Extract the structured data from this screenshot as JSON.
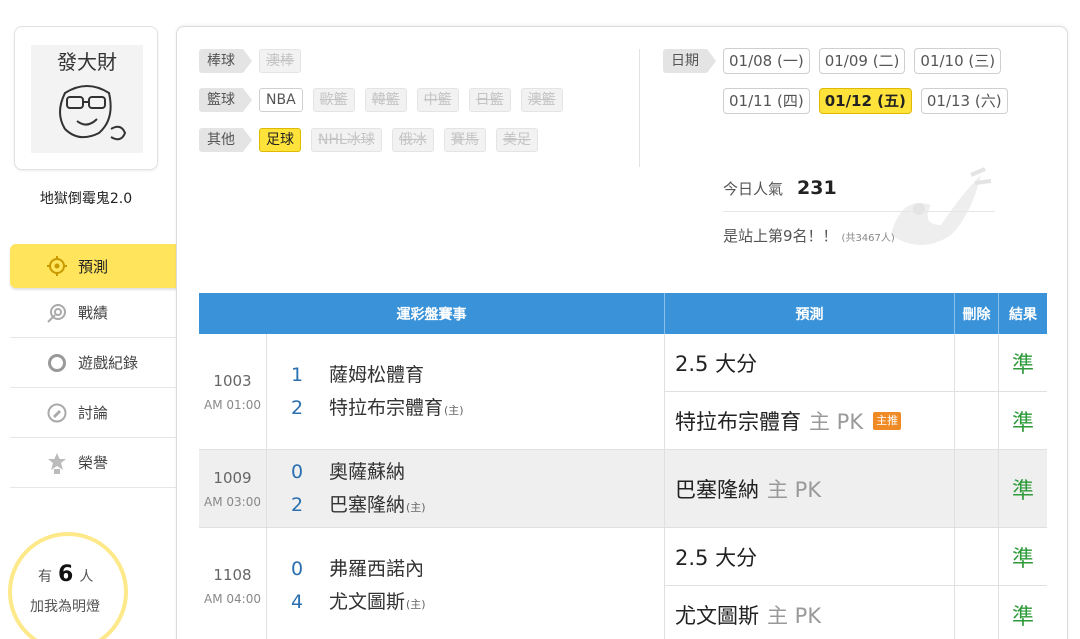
{
  "user": {
    "avatar_text": "發大財",
    "name": "地獄倒霉鬼2.0"
  },
  "nav": [
    {
      "label": "預測",
      "icon": "target-icon",
      "active": true
    },
    {
      "label": "戰績",
      "icon": "record-icon",
      "active": false
    },
    {
      "label": "遊戲紀錄",
      "icon": "history-ring-icon",
      "active": false
    },
    {
      "label": "討論",
      "icon": "discussion-icon",
      "active": false
    },
    {
      "label": "榮譽",
      "icon": "medal-icon",
      "active": false
    }
  ],
  "fans": {
    "prefix": "有",
    "count": "6",
    "suffix": "人",
    "caption": "加我為明燈"
  },
  "filters": {
    "baseball": {
      "label": "棒球",
      "options": [
        "澳棒"
      ]
    },
    "basketball": {
      "label": "籃球",
      "options": [
        "NBA",
        "歐籃",
        "韓籃",
        "中籃",
        "日籃",
        "澳籃"
      ]
    },
    "other": {
      "label": "其他",
      "options": [
        "足球",
        "NHL冰球",
        "俄冰",
        "賽馬",
        "美足"
      ]
    }
  },
  "dates": {
    "label": "日期",
    "row1": [
      "01/08 (一)",
      "01/09 (二)",
      "01/10 (三)"
    ],
    "row2": [
      "01/11 (四)",
      "01/12 (五)",
      "01/13 (六)"
    ],
    "selected": "01/12 (五)"
  },
  "stats": {
    "popularity_label": "今日人氣",
    "popularity_value": "231",
    "rank_text": "是站上第9名！！",
    "rank_total": "(共3467人)"
  },
  "table": {
    "headers": {
      "game": "運彩盤賽事",
      "prediction": "預測",
      "delete": "刪除",
      "result": "結果"
    },
    "matches": [
      {
        "game_no": "1003",
        "time": "AM 01:00",
        "away": {
          "score": "1",
          "name": "薩姆松體育"
        },
        "home": {
          "score": "2",
          "name": "特拉布宗體育",
          "tag": "(主)"
        },
        "predictions": [
          {
            "text": "2.5 大分",
            "side": "",
            "badge": "",
            "result": "準"
          },
          {
            "text": "特拉布宗體育",
            "side": "主 PK",
            "badge": "主推",
            "result": "準"
          }
        ]
      },
      {
        "game_no": "1009",
        "time": "AM 03:00",
        "away": {
          "score": "0",
          "name": "奧薩蘇納"
        },
        "home": {
          "score": "2",
          "name": "巴塞隆納",
          "tag": "(主)"
        },
        "predictions": [
          {
            "text": "巴塞隆納",
            "side": "主 PK",
            "badge": "",
            "result": "準"
          }
        ]
      },
      {
        "game_no": "1108",
        "time": "AM 04:00",
        "away": {
          "score": "0",
          "name": "弗羅西諾內"
        },
        "home": {
          "score": "4",
          "name": "尤文圖斯",
          "tag": "(主)"
        },
        "predictions": [
          {
            "text": "2.5 大分",
            "side": "",
            "badge": "",
            "result": "準"
          },
          {
            "text": "尤文圖斯",
            "side": "主 PK",
            "badge": "",
            "result": "準"
          }
        ]
      }
    ]
  }
}
